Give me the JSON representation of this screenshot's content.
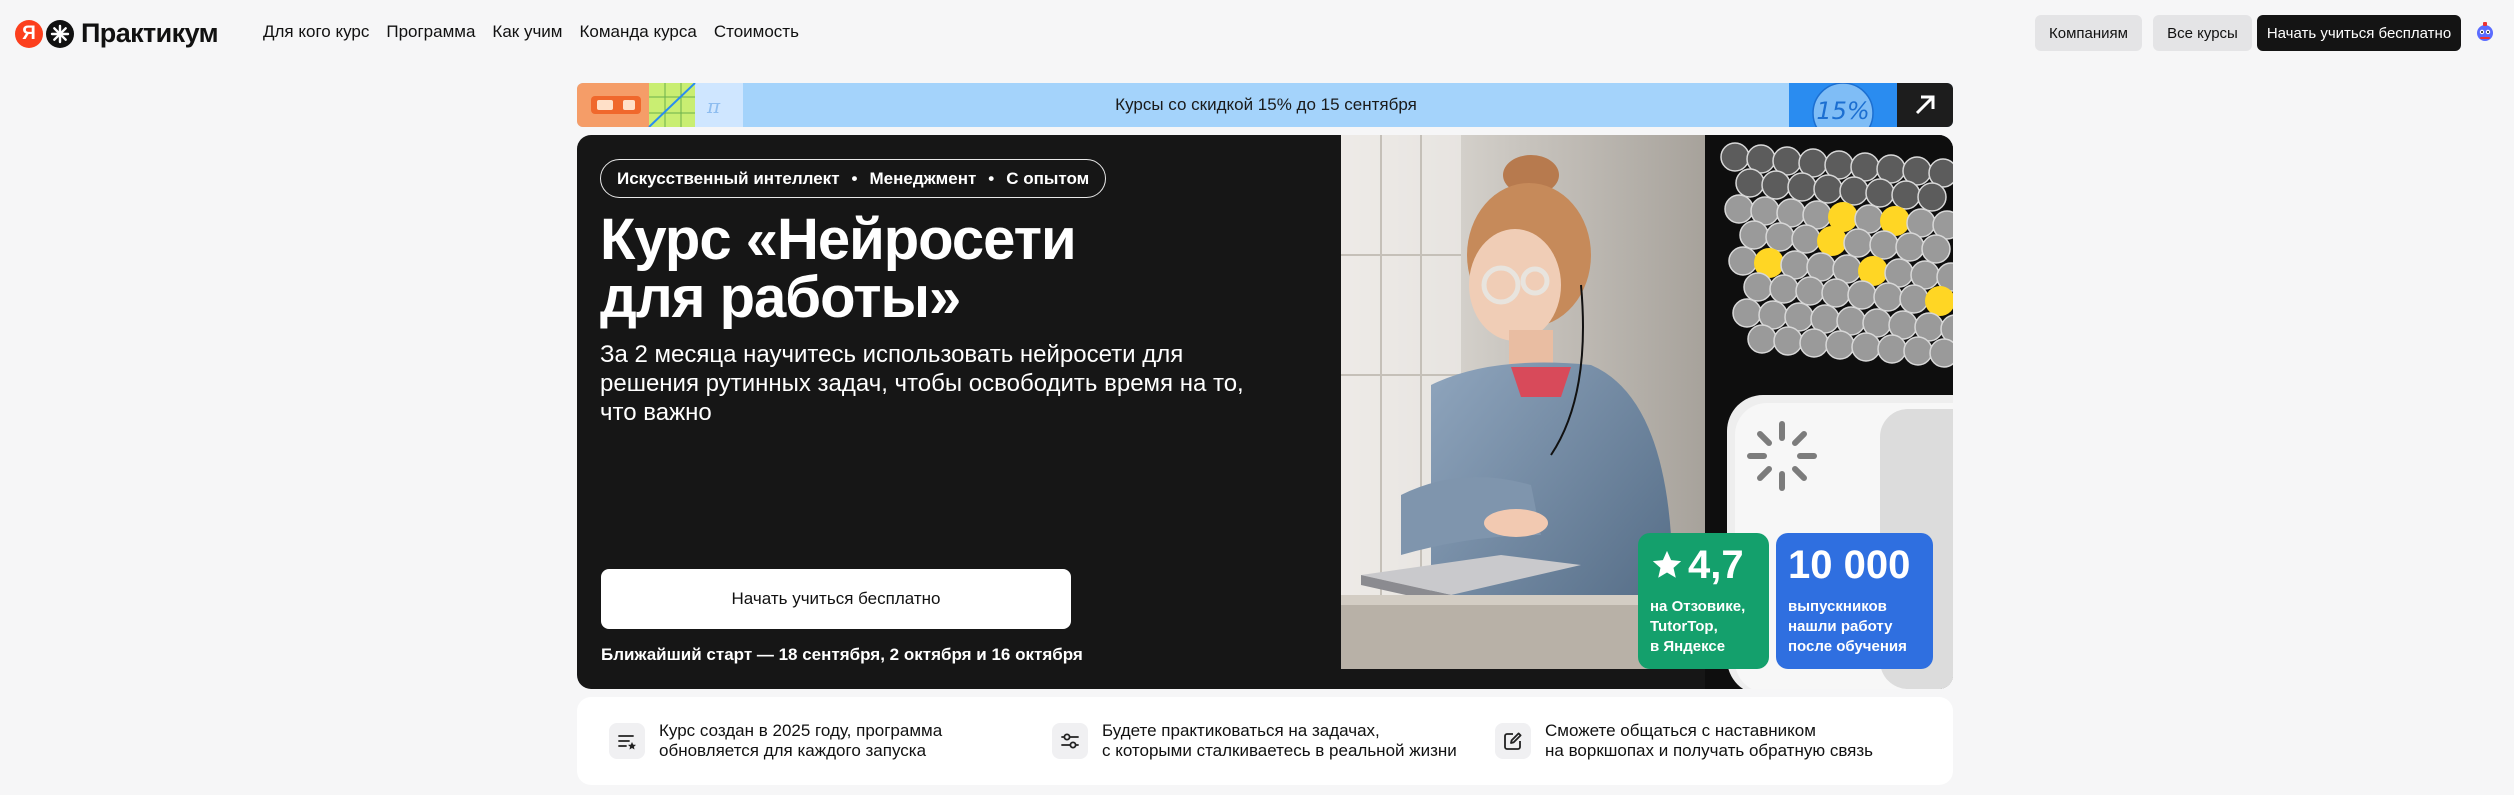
{
  "header": {
    "logo_letter": "Я",
    "logo_text": "Практикум",
    "nav": [
      "Для кого курс",
      "Программа",
      "Как учим",
      "Команда курса",
      "Стоимость"
    ],
    "companies_label": "Компаниям",
    "all_courses_label": "Все курсы",
    "start_free_label": "Начать учиться бесплатно"
  },
  "promo": {
    "text": "Курсы со скидкой 15% до 15 сентября",
    "badge": "15%",
    "colors": {
      "background": "#a4d3fb",
      "badge": "#2a8cf0",
      "arrow_bg": "#1d1d1d"
    }
  },
  "hero": {
    "tags": [
      "Искусственный интеллект",
      "Менеджмент",
      "С опытом"
    ],
    "title_line1": "Курс «Нейросети",
    "title_line2": "для работы»",
    "subtitle": "За 2 месяца научитесь использовать нейросети для решения рутинных задач, чтобы освободить время на то, что важно",
    "cta_label": "Начать учиться бесплатно",
    "start_info": "Ближайший старт — 18 сентября, 2 октября и 16 октября",
    "stats": [
      {
        "value": "4,7",
        "text": [
          "на Отзовике,",
          "TutorTop,",
          "в Яндексе"
        ],
        "color": "#14a06c",
        "icon": "star-icon"
      },
      {
        "value": "10 000",
        "text": [
          "выпускников",
          "нашли работу",
          "после обучения"
        ],
        "color": "#2f6fe0"
      }
    ]
  },
  "features": [
    {
      "icon": "list-star-icon",
      "lines": [
        "Курс создан в 2025 году, программа",
        "обновляется для каждого запуска"
      ]
    },
    {
      "icon": "sliders-icon",
      "lines": [
        "Будете практиковаться на задачах,",
        "с которыми сталкиваетесь в реальной жизни"
      ]
    },
    {
      "icon": "edit-icon",
      "lines": [
        "Сможете общаться с наставником",
        "на воркшопах и получать обратную связь"
      ]
    }
  ]
}
